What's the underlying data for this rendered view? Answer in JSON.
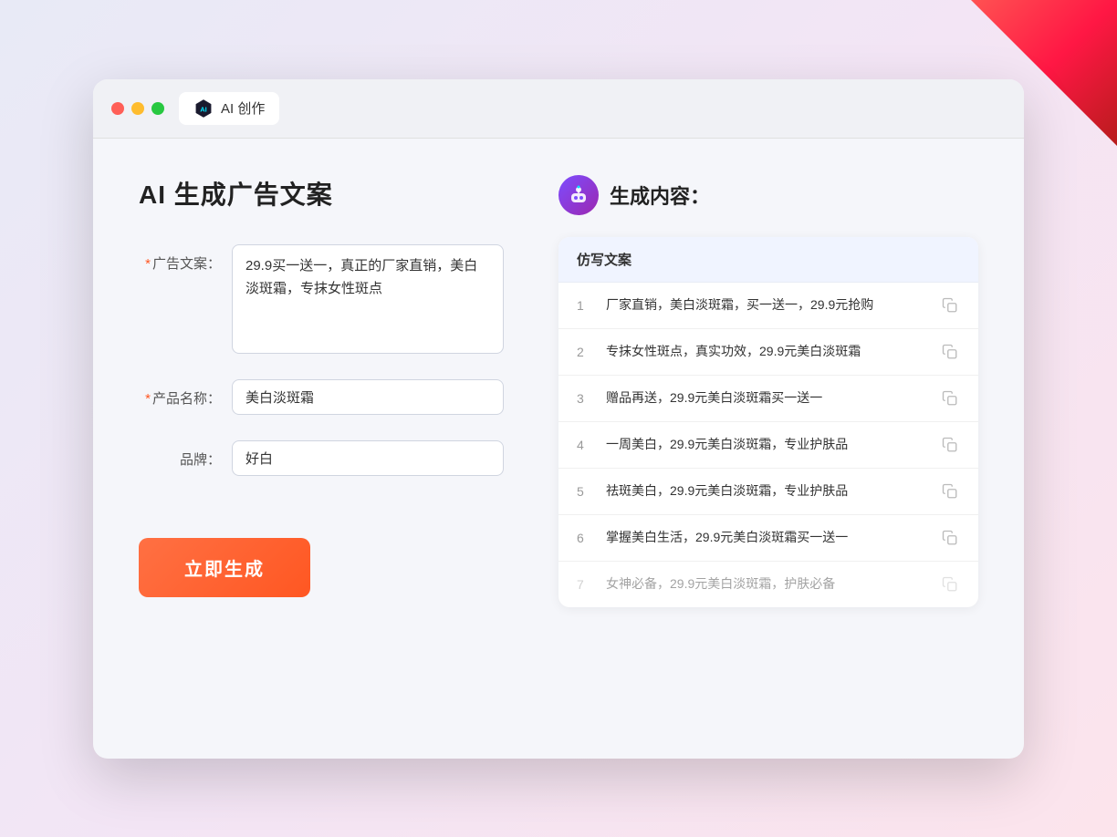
{
  "corner_deco": true,
  "browser": {
    "tab_label": "AI 创作",
    "tab_icon": "ai-icon"
  },
  "left_panel": {
    "title": "AI 生成广告文案",
    "fields": [
      {
        "label": "广告文案：",
        "required": true,
        "type": "textarea",
        "value": "29.9买一送一，真正的厂家直销，美白淡斑霜，专抹女性斑点",
        "name": "ad-copy-textarea"
      },
      {
        "label": "产品名称：",
        "required": true,
        "type": "input",
        "value": "美白淡斑霜",
        "name": "product-name-input"
      },
      {
        "label": "品牌：",
        "required": false,
        "type": "input",
        "value": "好白",
        "name": "brand-input"
      }
    ],
    "generate_button": "立即生成"
  },
  "right_panel": {
    "title": "生成内容：",
    "table_header": "仿写文案",
    "rows": [
      {
        "num": "1",
        "text": "厂家直销，美白淡斑霜，买一送一，29.9元抢购",
        "faded": false
      },
      {
        "num": "2",
        "text": "专抹女性斑点，真实功效，29.9元美白淡斑霜",
        "faded": false
      },
      {
        "num": "3",
        "text": "赠品再送，29.9元美白淡斑霜买一送一",
        "faded": false
      },
      {
        "num": "4",
        "text": "一周美白，29.9元美白淡斑霜，专业护肤品",
        "faded": false
      },
      {
        "num": "5",
        "text": "祛斑美白，29.9元美白淡斑霜，专业护肤品",
        "faded": false
      },
      {
        "num": "6",
        "text": "掌握美白生活，29.9元美白淡斑霜买一送一",
        "faded": false
      },
      {
        "num": "7",
        "text": "女神必备，29.9元美白淡斑霜，护肤必备",
        "faded": true
      }
    ]
  }
}
